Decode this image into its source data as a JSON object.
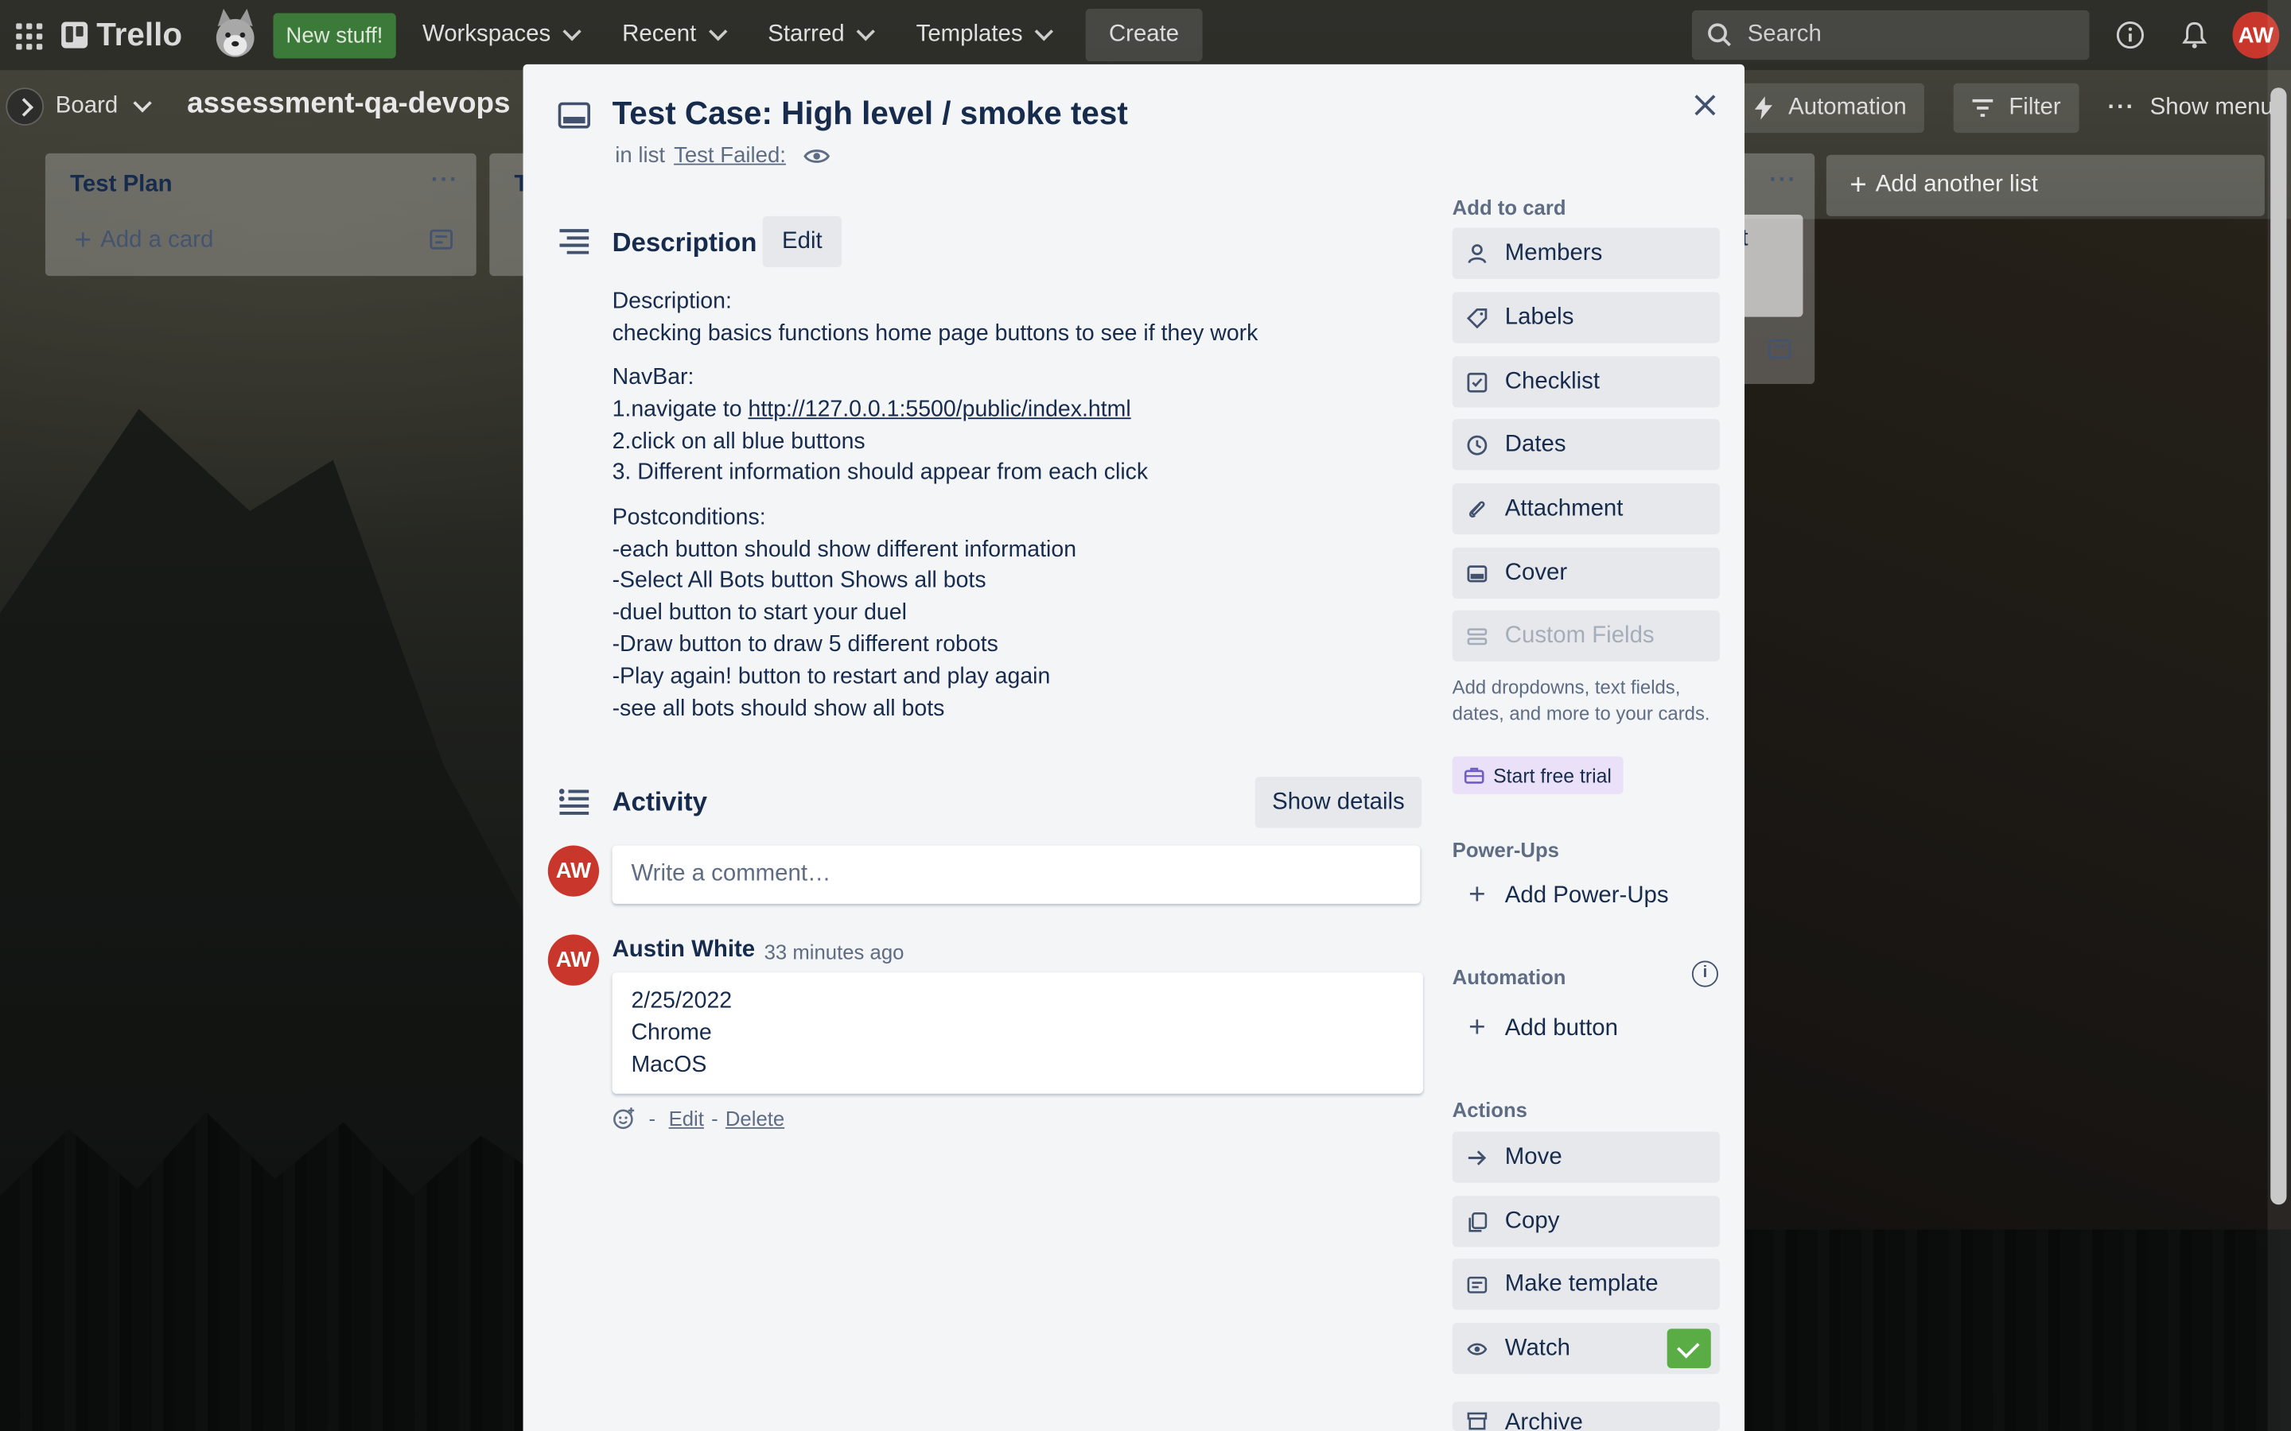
{
  "topnav": {
    "brand": "Trello",
    "new_stuff": "New stuff!",
    "menus": [
      "Workspaces",
      "Recent",
      "Starred",
      "Templates"
    ],
    "create": "Create",
    "search_placeholder": "Search",
    "avatar_initials": "AW"
  },
  "boardbar": {
    "view": "Board",
    "title": "assessment-qa-devops",
    "automation": "Automation",
    "filter": "Filter",
    "show_menu": "Show menu"
  },
  "lists": {
    "first_title": "Test Plan",
    "second_title_partial": "T",
    "add_card": "Add a card",
    "add_another_list": "Add another list",
    "partial_card_text": "t"
  },
  "card": {
    "title": "Test Case: High level / smoke test",
    "in_list_prefix": "in list",
    "list_name": "Test Failed:",
    "description_heading": "Description",
    "edit_label": "Edit",
    "description": {
      "p1_l1": "Description:",
      "p1_l2": "checking basics functions home page buttons to see if they work",
      "p2_l1": "NavBar:",
      "p2_l2_prefix": "1.navigate to ",
      "p2_l2_link": "http://127.0.0.1:5500/public/index.html",
      "p2_l3": "2.click on all blue buttons",
      "p2_l4": "3. Different information should appear from each click",
      "p3_l1": "Postconditions:",
      "p3_l2": "-each button should show different information",
      "p3_l3": "-Select All Bots button Shows all bots",
      "p3_l4": "-duel button to start your duel",
      "p3_l5": "-Draw button to draw 5 different robots",
      "p3_l6": "-Play again! button to restart and play again",
      "p3_l7": "-see all bots should show all bots"
    },
    "activity_heading": "Activity",
    "show_details": "Show details",
    "comment_placeholder": "Write a comment…",
    "comment": {
      "author": "Austin White",
      "time": "33 minutes ago",
      "line1": "2/25/2022",
      "line2": "Chrome",
      "line3": "MacOS",
      "sep": "-",
      "edit": "Edit",
      "delete": "Delete",
      "avatar_initials": "AW"
    },
    "my_avatar_initials": "AW"
  },
  "sidebar": {
    "add_to_card": "Add to card",
    "members": "Members",
    "labels": "Labels",
    "checklist": "Checklist",
    "dates": "Dates",
    "attachment": "Attachment",
    "cover": "Cover",
    "custom_fields": "Custom Fields",
    "upsell": "Add dropdowns, text fields, dates, and more to your cards.",
    "start_trial": "Start free trial",
    "power_ups": "Power-Ups",
    "add_power_ups": "Add Power-Ups",
    "automation": "Automation",
    "add_button": "Add button",
    "actions": "Actions",
    "move": "Move",
    "copy": "Copy",
    "make_template": "Make template",
    "watch": "Watch",
    "archive": "Archive"
  },
  "colors": {
    "modal_bg": "#f4f5f7",
    "text": "#172b4d",
    "muted": "#5e6c84",
    "avatar_red": "#c9372c",
    "watch_green": "#5aac44",
    "new_stuff_green": "#3c7a3a"
  }
}
